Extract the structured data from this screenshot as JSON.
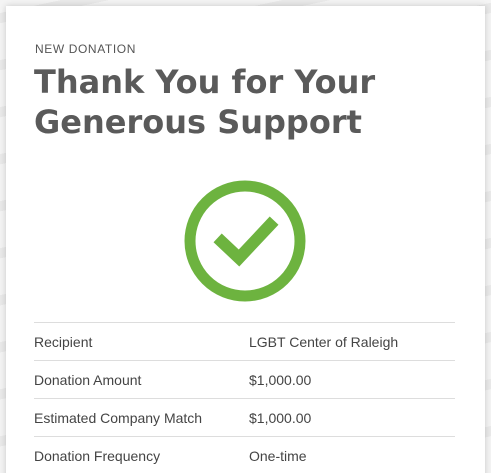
{
  "header": {
    "eyebrow": "NEW DONATION",
    "title": "Thank You for Your Generous Support"
  },
  "status_icon": "check-circle-icon",
  "colors": {
    "accent_green": "#6db33f",
    "title_text": "#5a5a5a"
  },
  "details": [
    {
      "label": "Recipient",
      "value": "LGBT Center of Raleigh"
    },
    {
      "label": "Donation Amount",
      "value": "$1,000.00"
    },
    {
      "label": "Estimated Company Match",
      "value": "$1,000.00"
    },
    {
      "label": "Donation Frequency",
      "value": "One-time"
    }
  ]
}
